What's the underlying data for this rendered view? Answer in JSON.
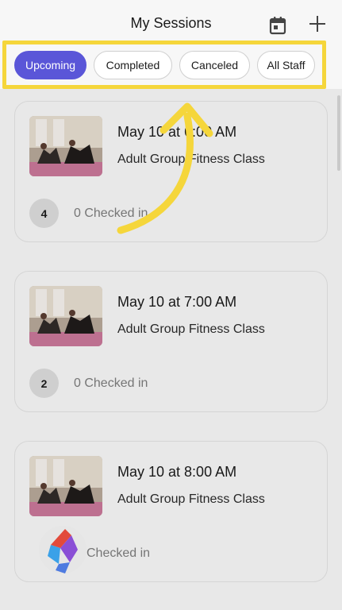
{
  "header": {
    "title": "My Sessions",
    "calendar_icon": "calendar-icon",
    "add_icon": "plus-icon"
  },
  "filters": [
    {
      "label": "Upcoming",
      "active": true
    },
    {
      "label": "Completed",
      "active": false
    },
    {
      "label": "Canceled",
      "active": false
    },
    {
      "label": "All Staff",
      "active": false
    }
  ],
  "sessions": [
    {
      "when": "May 10 at 6:00 AM",
      "class_name": "Adult Group Fitness Class",
      "count": "4",
      "checked_in": "0 Checked in"
    },
    {
      "when": "May 10 at 7:00 AM",
      "class_name": "Adult Group Fitness Class",
      "count": "2",
      "checked_in": "0 Checked in"
    },
    {
      "when": "May 10 at 8:00 AM",
      "class_name": "Adult Group Fitness Class",
      "count": "",
      "checked_in": "Checked in"
    }
  ],
  "colors": {
    "accent": "#5a56d8",
    "highlight": "#f5d63b",
    "background": "#f7f7f7"
  }
}
